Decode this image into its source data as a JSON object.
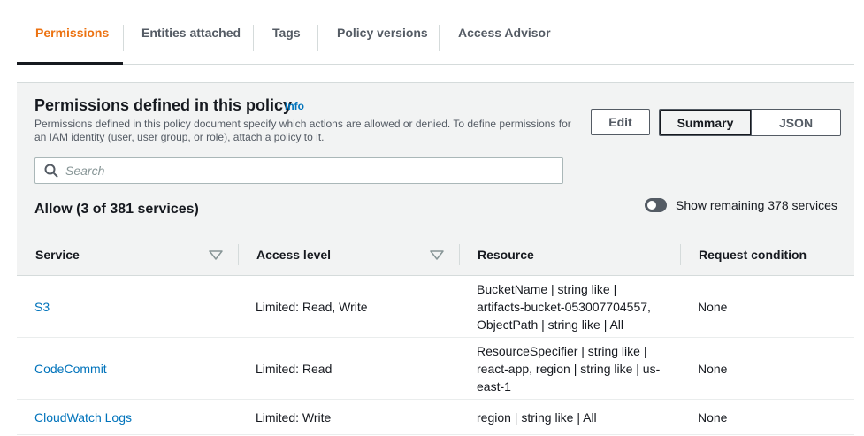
{
  "tabs": [
    {
      "label": "Permissions",
      "active": true
    },
    {
      "label": "Entities attached",
      "active": false
    },
    {
      "label": "Tags",
      "active": false
    },
    {
      "label": "Policy versions",
      "active": false
    },
    {
      "label": "Access Advisor",
      "active": false
    }
  ],
  "panel": {
    "title": "Permissions defined in this policy",
    "info_label": "Info",
    "description": "Permissions defined in this policy document specify which actions are allowed or denied. To define permissions for an IAM identity (user, user group, or role), attach a policy to it.",
    "edit_label": "Edit",
    "view_toggle": {
      "summary_label": "Summary",
      "json_label": "JSON",
      "selected": "Summary"
    }
  },
  "search": {
    "placeholder": "Search",
    "value": ""
  },
  "allow_section": {
    "title": "Allow (3 of 381 services)",
    "toggle_label": "Show remaining 378 services",
    "toggle_on": false
  },
  "table": {
    "columns": [
      "Service",
      "Access level",
      "Resource",
      "Request condition"
    ],
    "rows": [
      {
        "service": "S3",
        "access_level": "Limited: Read, Write",
        "resource": "BucketName | string like | artifacts-bucket-053007704557, ObjectPath | string like | All",
        "condition": "None"
      },
      {
        "service": "CodeCommit",
        "access_level": "Limited: Read",
        "resource": "ResourceSpecifier | string like | react-app, region | string like | us-east-1",
        "condition": "None"
      },
      {
        "service": "CloudWatch Logs",
        "access_level": "Limited: Write",
        "resource": "region | string like | All",
        "condition": "None"
      }
    ]
  },
  "colors": {
    "accent": "#ec7211",
    "link": "#0073bb",
    "header_bg": "#f2f3f3",
    "text": "#16191f"
  }
}
